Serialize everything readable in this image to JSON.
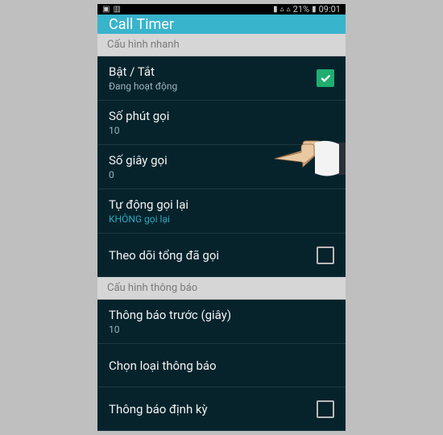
{
  "status": {
    "battery_pct": "21%",
    "clock": "09:01"
  },
  "appbar": {
    "title": "Call Timer"
  },
  "sections": {
    "quick": {
      "header": "Cấu hình nhanh",
      "toggle": {
        "title": "Bật / Tắt",
        "sub": "Đang hoạt động",
        "checked": true
      },
      "minutes": {
        "title": "Số phút gọi",
        "value": "10"
      },
      "seconds": {
        "title": "Số giây gọi",
        "value": "0"
      },
      "redial": {
        "title": "Tự động gọi lại",
        "value": "KHÔNG gọi lại"
      },
      "track": {
        "title": "Theo dõi tổng đã gọi",
        "checked": false
      }
    },
    "notify": {
      "header": "Cấu hình thông báo",
      "before": {
        "title": "Thông báo trước (giây)",
        "value": "10"
      },
      "type": {
        "title": "Chọn loại thông báo"
      },
      "periodic": {
        "title": "Thông báo định kỳ",
        "checked": false
      }
    }
  },
  "colors": {
    "accent": "#38b4cc",
    "bg_dark": "#06232c",
    "check_green": "#1fae6f"
  }
}
